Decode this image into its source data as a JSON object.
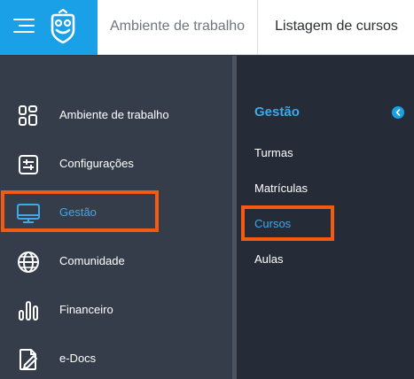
{
  "header": {
    "breadcrumbs": [
      "Ambiente de trabalho",
      "Listagem de cursos"
    ]
  },
  "sidebar": {
    "items": [
      {
        "label": "Ambiente de trabalho",
        "icon": "dashboard-grid-icon"
      },
      {
        "label": "Configurações",
        "icon": "settings-sliders-icon"
      },
      {
        "label": "Gestão",
        "icon": "monitor-icon",
        "active": true
      },
      {
        "label": "Comunidade",
        "icon": "globe-icon"
      },
      {
        "label": "Financeiro",
        "icon": "bar-chart-icon"
      },
      {
        "label": "e-Docs",
        "icon": "document-edit-icon"
      }
    ]
  },
  "submenu": {
    "title": "Gestão",
    "items": [
      {
        "label": "Turmas"
      },
      {
        "label": "Matrículas"
      },
      {
        "label": "Cursos",
        "active": true
      },
      {
        "label": "Aulas"
      }
    ]
  },
  "colors": {
    "brand": "#1aa0e6",
    "active_text": "#3ea9ea",
    "highlight": "#f45a12",
    "sidebar_bg": "#353d4a",
    "submenu_bg": "#252c38"
  }
}
